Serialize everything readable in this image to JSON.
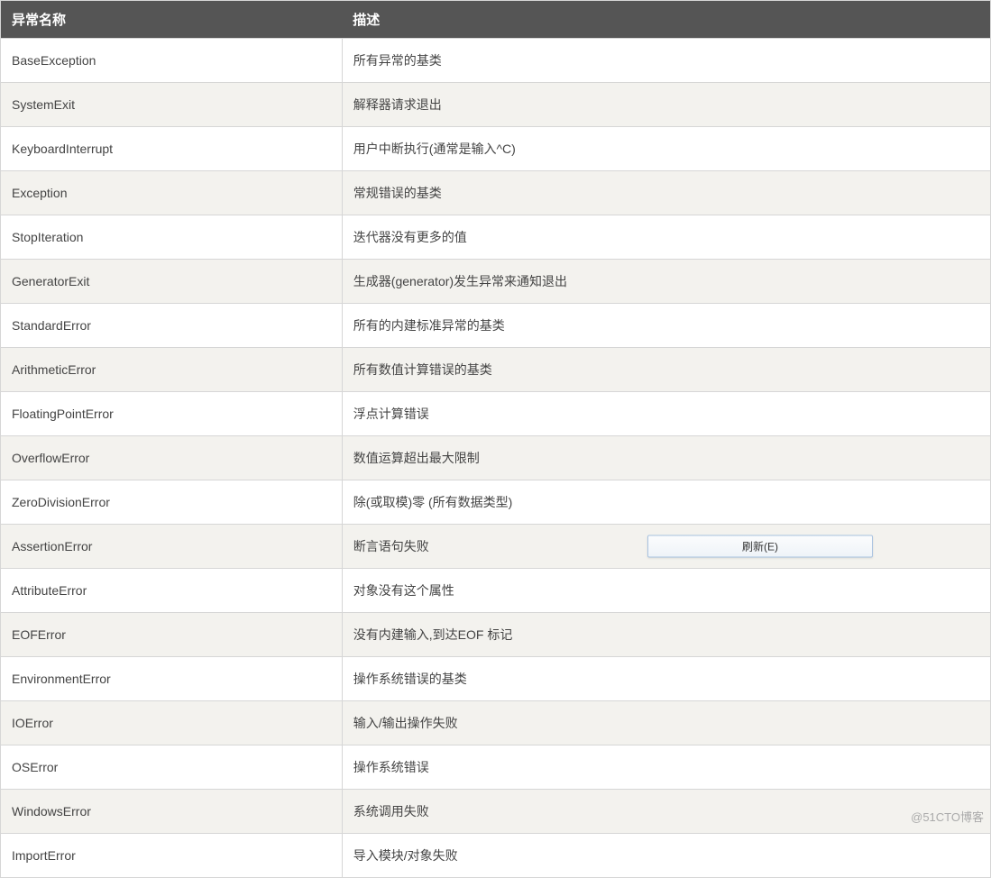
{
  "table": {
    "headers": {
      "name": "异常名称",
      "desc": "描述"
    },
    "rows": [
      {
        "name": "BaseException",
        "desc": "所有异常的基类"
      },
      {
        "name": "SystemExit",
        "desc": "解释器请求退出"
      },
      {
        "name": "KeyboardInterrupt",
        "desc": "用户中断执行(通常是输入^C)"
      },
      {
        "name": "Exception",
        "desc": "常规错误的基类"
      },
      {
        "name": "StopIteration",
        "desc": "迭代器没有更多的值"
      },
      {
        "name": "GeneratorExit",
        "desc": "生成器(generator)发生异常来通知退出"
      },
      {
        "name": "StandardError",
        "desc": "所有的内建标准异常的基类"
      },
      {
        "name": "ArithmeticError",
        "desc": "所有数值计算错误的基类"
      },
      {
        "name": "FloatingPointError",
        "desc": "浮点计算错误"
      },
      {
        "name": "OverflowError",
        "desc": "数值运算超出最大限制"
      },
      {
        "name": "ZeroDivisionError",
        "desc": "除(或取模)零 (所有数据类型)"
      },
      {
        "name": "AssertionError",
        "desc": "断言语句失败"
      },
      {
        "name": "AttributeError",
        "desc": "对象没有这个属性"
      },
      {
        "name": "EOFError",
        "desc": "没有内建输入,到达EOF 标记"
      },
      {
        "name": "EnvironmentError",
        "desc": "操作系统错误的基类"
      },
      {
        "name": "IOError",
        "desc": "输入/输出操作失败"
      },
      {
        "name": "OSError",
        "desc": "操作系统错误"
      },
      {
        "name": "WindowsError",
        "desc": "系统调用失败"
      },
      {
        "name": "ImportError",
        "desc": "导入模块/对象失败"
      }
    ]
  },
  "contextMenu": {
    "refresh": "刷新(E)"
  },
  "watermark": "@51CTO博客",
  "refreshRowIndex": 11
}
